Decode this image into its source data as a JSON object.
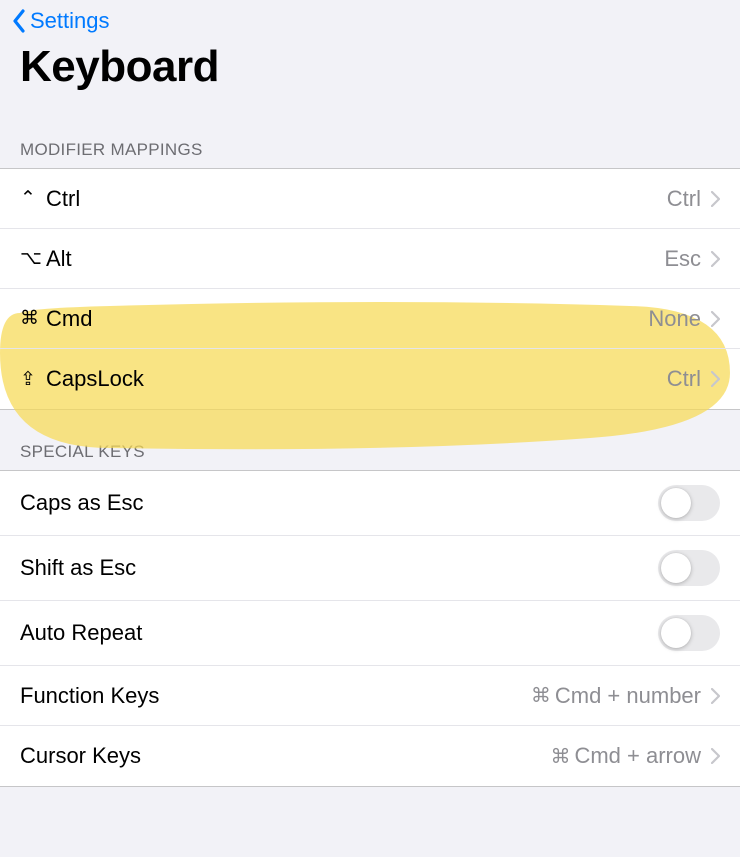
{
  "nav": {
    "back_label": "Settings",
    "title": "Keyboard"
  },
  "sections": {
    "modifier_header": "MODIFIER MAPPINGS",
    "special_header": "SPECIAL KEYS"
  },
  "modifiers": [
    {
      "icon": "⌃",
      "label": "Ctrl",
      "value": "Ctrl"
    },
    {
      "icon": "⌥",
      "label": "Alt",
      "value": "Esc"
    },
    {
      "icon": "⌘",
      "label": "Cmd",
      "value": "None"
    },
    {
      "icon": "⇪",
      "label": "CapsLock",
      "value": "Ctrl"
    }
  ],
  "special": {
    "caps_as_esc": {
      "label": "Caps as Esc",
      "on": false
    },
    "shift_as_esc": {
      "label": "Shift as Esc",
      "on": false
    },
    "auto_repeat": {
      "label": "Auto Repeat",
      "on": false
    },
    "function_keys": {
      "label": "Function Keys",
      "value_icon": "⌘",
      "value": "Cmd + number"
    },
    "cursor_keys": {
      "label": "Cursor Keys",
      "value_icon": "⌘",
      "value": "Cmd + arrow"
    }
  },
  "annotation": {
    "color": "#f6d955"
  }
}
